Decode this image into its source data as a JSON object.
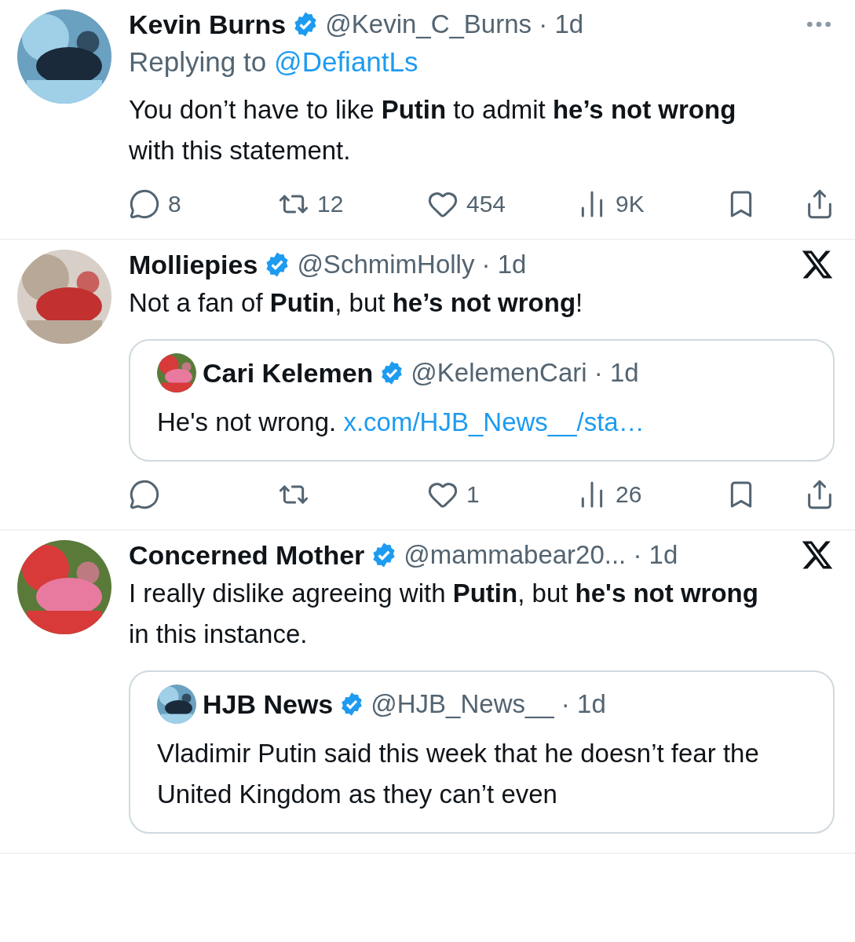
{
  "tweets": [
    {
      "name": "Kevin Burns",
      "verified": true,
      "meta": "@Kevin_C_Burns · 1d",
      "corner": {
        "kind": "more"
      },
      "replying_label": "Replying to",
      "replying_handle": "@DefiantLs",
      "text": "You don’t have to like **Putin** to admit **he’s not wrong** with this statement.",
      "actions": {
        "replies": "8",
        "reposts": "12",
        "likes": "454",
        "views": "9K"
      }
    },
    {
      "name": "Molliepies",
      "verified": true,
      "meta": "@SchmimHolly · 1d",
      "corner": {
        "kind": "x-logo"
      },
      "text": "Not a fan of **Putin**, but **he’s not wrong**!",
      "quote": {
        "name": "Cari Kelemen",
        "verified": true,
        "meta": "@KelemenCari · 1d",
        "text": "He's not wrong.",
        "link": "x.com/HJB_News__/sta…"
      },
      "actions": {
        "likes": "1",
        "views": "26"
      }
    },
    {
      "name": "Concerned Mother",
      "verified": true,
      "meta": "@mammabear20... · 1d",
      "corner": {
        "kind": "x-logo"
      },
      "text": "I really dislike agreeing with **Putin**, but **he's not wrong** in this instance.",
      "quote": {
        "name": "HJB News",
        "verified": true,
        "meta": "@HJB_News__ · 1d",
        "text": "Vladimir Putin said this week that he doesn’t fear the United Kingdom as they can’t even"
      }
    }
  ]
}
